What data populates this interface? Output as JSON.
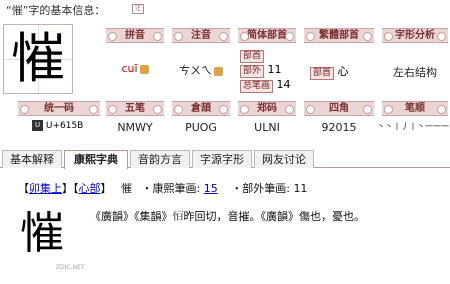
{
  "title": "“慛”字的基本信息：",
  "char": "慛",
  "title_icon_text": "注",
  "row1": {
    "pinyin": {
      "label": "拼音",
      "value": "cuī"
    },
    "zhuyin": {
      "label": "注音",
      "value": "ㄘㄨㄟ"
    },
    "simplified_radical": {
      "label": "简体部首",
      "bushou_tag": "部首",
      "bushou": "",
      "buwai_tag": "部外",
      "buwai": "11",
      "zongbihua_tag": "总笔画",
      "zongbihua": "14"
    },
    "traditional_radical": {
      "label": "繁體部首",
      "bushou_tag": "部首",
      "bushou": "心"
    },
    "structure": {
      "label": "字形分析",
      "value": "左右结构"
    }
  },
  "row2": {
    "unicode": {
      "label": "统一码",
      "value": "U+615B"
    },
    "wubi": {
      "label": "五笔",
      "value": "NMWY"
    },
    "cangjie": {
      "label": "倉頡",
      "value": "PUOG"
    },
    "zhengma": {
      "label": "郑码",
      "value": "ULNI"
    },
    "sijiao": {
      "label": "四角",
      "value": "92015"
    },
    "bishun": {
      "label": "笔顺",
      "value": "丶丶丨丿丨丶一一一"
    }
  },
  "tabs": [
    {
      "label": "基本解释",
      "active": false
    },
    {
      "label": "康熙字典",
      "active": true
    },
    {
      "label": "音韵方言",
      "active": false
    },
    {
      "label": "字源字形",
      "active": false
    },
    {
      "label": "网友讨论",
      "active": false
    }
  ],
  "kangxi": {
    "bracket_open": "【",
    "section": "卯集上",
    "bracket_mid": "】【",
    "radical_section": "心部",
    "bracket_close": "】",
    "char": "慛",
    "stroke_label": "・康熙筆画:",
    "stroke_value": "15",
    "outer_label": "・部外筆画:",
    "outer_value": "11",
    "content": "《廣韻》《集韻》𢘆昨回切，音摧。《廣韻》傷也，憂也。",
    "watermark": "ZDIC.NET"
  }
}
